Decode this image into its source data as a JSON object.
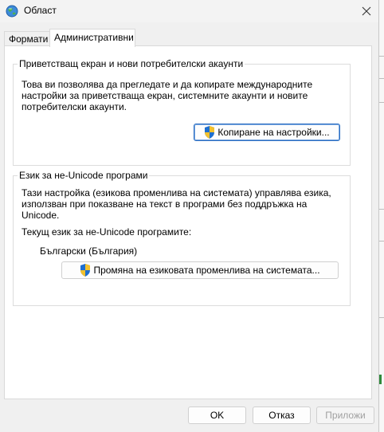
{
  "window": {
    "title": "Област"
  },
  "tabs": [
    {
      "label": "Формати"
    },
    {
      "label": "Административни"
    }
  ],
  "welcome_group": {
    "title": "Приветстващ екран и нови потребителски акаунти",
    "description": "Това ви позволява да прегледате и да копирате международните\nнастройки за приветстваща екран, системните акаунти и новите\nпотребителски акаунти.",
    "copy_button": "Копиране на настройки..."
  },
  "unicode_group": {
    "title": "Език за не-Unicode програми",
    "description": "Тази настройка (езикова променлива на системата) управлява езика,\nизползван при показване на текст в програми без поддръжка на\nUnicode.",
    "current_label": "Текущ език за не-Unicode програмите:",
    "current_value": "Български (България)",
    "change_button": "Промяна на езиковата променлива на системата..."
  },
  "buttons": {
    "ok": "OK",
    "cancel": "Отказ",
    "apply": "Приложи"
  },
  "colors": {
    "accent": "#2b6ec2",
    "shield_blue": "#1e6fd0",
    "shield_yellow": "#f2c12e"
  }
}
